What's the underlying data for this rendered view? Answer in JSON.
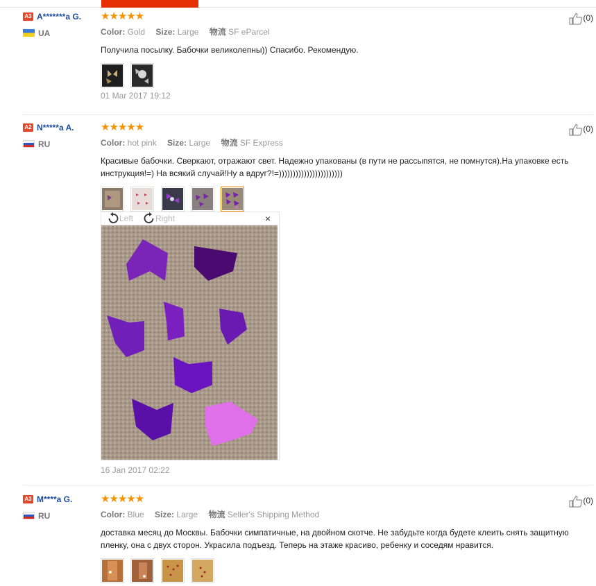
{
  "reviews": [
    {
      "level": "A3",
      "name": "A*******a G.",
      "country": "UA",
      "stars": "★★★★★",
      "color_label": "Color:",
      "color": "Gold",
      "size_label": "Size:",
      "size": "Large",
      "ship_label": "物流",
      "shipping": "SF eParcel",
      "text": "Получила посылку. Бабочки великолепны)) Спасибо. Рекомендую.",
      "date": "01 Mar 2017 19:12",
      "helpful": "(0)"
    },
    {
      "level": "A2",
      "name": "N*****a A.",
      "country": "RU",
      "stars": "★★★★★",
      "color_label": "Color:",
      "color": "hot pink",
      "size_label": "Size:",
      "size": "Large",
      "ship_label": "物流",
      "shipping": "SF Express",
      "text": "Красивые бабочки. Сверкают, отражают свет. Надежно упакованы (в пути не рассыпятся, не помнутся).На упаковке есть инструкция!=) На всякий случай!Ну а вдруг?!=)))))))))))))))))))))))",
      "date": "16 Jan 2017 02:22",
      "helpful": "(0)"
    },
    {
      "level": "A3",
      "name": "M****a G.",
      "country": "RU",
      "stars": "★★★★★",
      "color_label": "Color:",
      "color": "Blue",
      "size_label": "Size:",
      "size": "Large",
      "ship_label": "物流",
      "shipping": "Seller's Shipping Method",
      "text": "доставка месяц до Москвы. Бабочки симпатичные, на двойном скотче. Не забудьте когда будете клеить снять защитную пленку, она с двух сторон. Украсила подъезд. Теперь на этаже красиво, ребенку и соседям нравится.",
      "date": "",
      "helpful": "(0)"
    }
  ],
  "viewer": {
    "left_label": "Left",
    "right_label": "Right",
    "close": "×"
  }
}
